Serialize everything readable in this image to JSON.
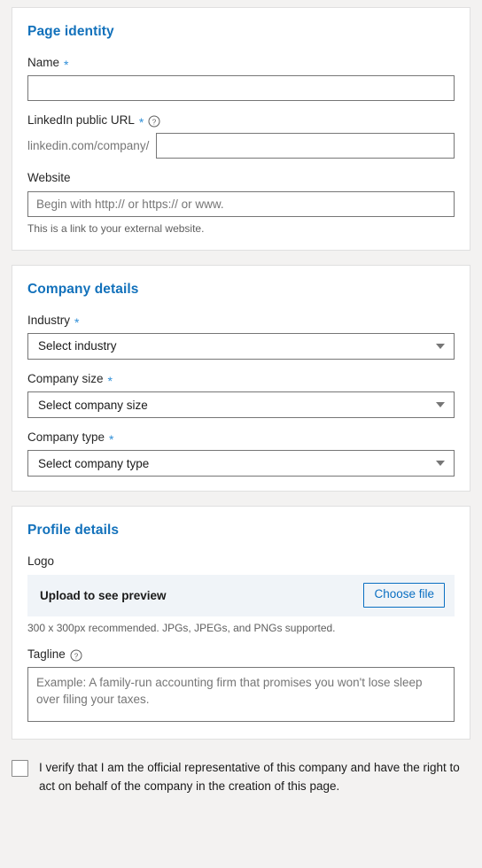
{
  "sections": {
    "page_identity": {
      "title": "Page identity",
      "name": {
        "label": "Name",
        "required_marker": "*",
        "value": "",
        "placeholder": ""
      },
      "linkedin_url": {
        "label": "LinkedIn public URL",
        "required_marker": "*",
        "help_icon": "help-circle-icon",
        "prefix": "linkedin.com/company/",
        "value": "",
        "placeholder": ""
      },
      "website": {
        "label": "Website",
        "value": "",
        "placeholder": "Begin with http:// or https:// or www.",
        "helper": "This is a link to your external website."
      }
    },
    "company_details": {
      "title": "Company details",
      "industry": {
        "label": "Industry",
        "required_marker": "*",
        "selected": "Select industry",
        "arrow_icon": "chevron-down-icon"
      },
      "company_size": {
        "label": "Company size",
        "required_marker": "*",
        "selected": "Select company size",
        "arrow_icon": "chevron-down-icon"
      },
      "company_type": {
        "label": "Company type",
        "required_marker": "*",
        "selected": "Select company type",
        "arrow_icon": "chevron-down-icon"
      }
    },
    "profile_details": {
      "title": "Profile details",
      "logo": {
        "label": "Logo",
        "preview_text": "Upload to see preview",
        "button_label": "Choose file",
        "helper": "300 x 300px recommended. JPGs, JPEGs, and PNGs supported."
      },
      "tagline": {
        "label": "Tagline",
        "help_icon": "help-circle-icon",
        "value": "",
        "placeholder": "Example: A family-run accounting firm that promises you won't lose sleep over filing your taxes."
      }
    }
  },
  "verification": {
    "checked": false,
    "text": "I verify that I am the official representative of this company and have the right to act on behalf of the company in the creation of this page."
  },
  "colors": {
    "accent_blue": "#1271bb",
    "link_blue": "#0a6fc2",
    "required_blue": "#2f8fd8",
    "page_background": "#f3f2f1",
    "card_background": "#ffffff",
    "upload_strip_background": "#f0f4f8",
    "border_gray": "#767676",
    "muted_text": "#5e5e5e"
  }
}
